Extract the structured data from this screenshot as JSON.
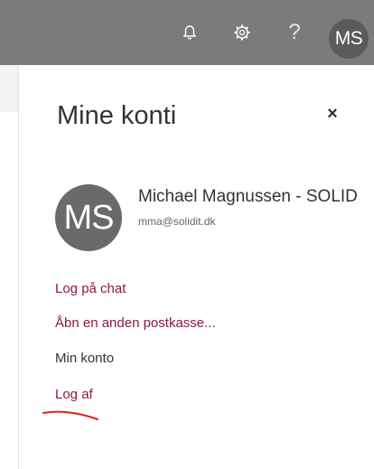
{
  "header": {
    "help_label": "?",
    "avatar_initials": "MS",
    "icons": [
      "bell-icon",
      "gear-icon",
      "help-icon"
    ]
  },
  "account_panel": {
    "title": "Mine konti",
    "close_label": "×",
    "avatar_initials": "MS",
    "user_name": "Michael Magnussen - SOLID",
    "user_email": "mma@solidit.dk",
    "links": {
      "chat": "Log på chat",
      "other_mailbox": "Åbn en anden postkasse...",
      "my_account": "Min konto",
      "logout": "Log af"
    }
  },
  "colors": {
    "topbar": "#7b7b7b",
    "avatar": "#5b5b5b",
    "link": "#8a1c3a",
    "annotation": "#e0211f"
  }
}
